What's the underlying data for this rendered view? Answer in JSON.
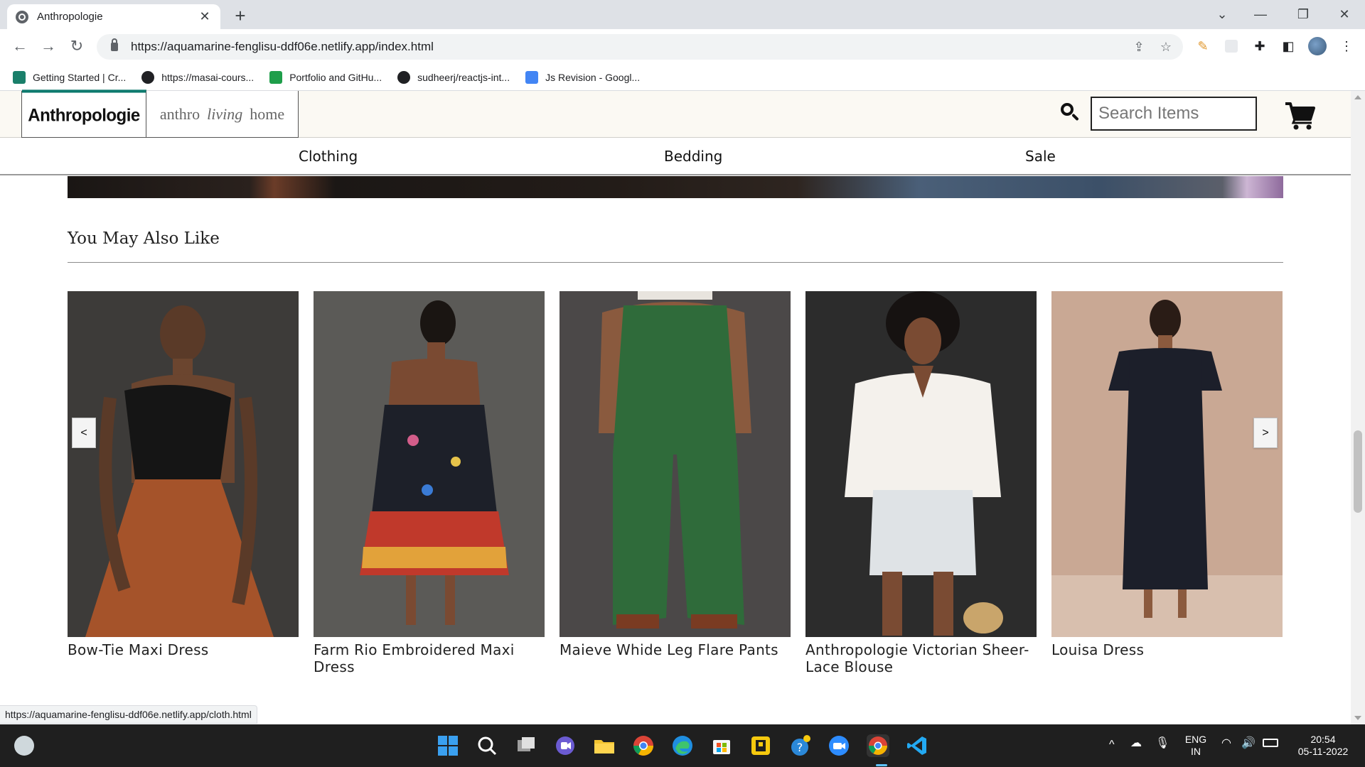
{
  "browser": {
    "tab_title": "Anthropologie",
    "tab_close": "✕",
    "new_tab": "+",
    "url": "https://aquamarine-fenglisu-ddf06e.netlify.app/index.html",
    "status_url": "https://aquamarine-fenglisu-ddf06e.netlify.app/cloth.html",
    "bookmarks": [
      {
        "label": "Getting Started | Cr...",
        "color": "#1a7f6a"
      },
      {
        "label": "https://masai-cours...",
        "color": "#202124"
      },
      {
        "label": "Portfolio and GitHu...",
        "color": "#1e9e4a"
      },
      {
        "label": "sudheerj/reactjs-int...",
        "color": "#202124"
      },
      {
        "label": "Js Revision - Googl...",
        "color": "#4285f4"
      }
    ]
  },
  "header": {
    "brand": "Anthropologie",
    "sub_brand": {
      "part1": "anthro",
      "part2": "living",
      "part3": "home"
    },
    "search_placeholder": "Search Items",
    "accent_color": "#0d7a6e"
  },
  "nav": {
    "categories": [
      "Clothing",
      "Bedding",
      "Sale"
    ]
  },
  "main": {
    "section_title": "You May Also Like",
    "prev_label": "<",
    "next_label": ">",
    "products": [
      {
        "name": "Bow-Tie Maxi Dress"
      },
      {
        "name": "Farm Rio Embroidered Maxi Dress"
      },
      {
        "name": "Maieve Whide Leg Flare Pants"
      },
      {
        "name": "Anthropologie Victorian Sheer-Lace Blouse"
      },
      {
        "name": "Louisa Dress"
      }
    ]
  },
  "taskbar": {
    "lang_top": "ENG",
    "lang_bottom": "IN",
    "time": "20:54",
    "date": "05-11-2022"
  }
}
